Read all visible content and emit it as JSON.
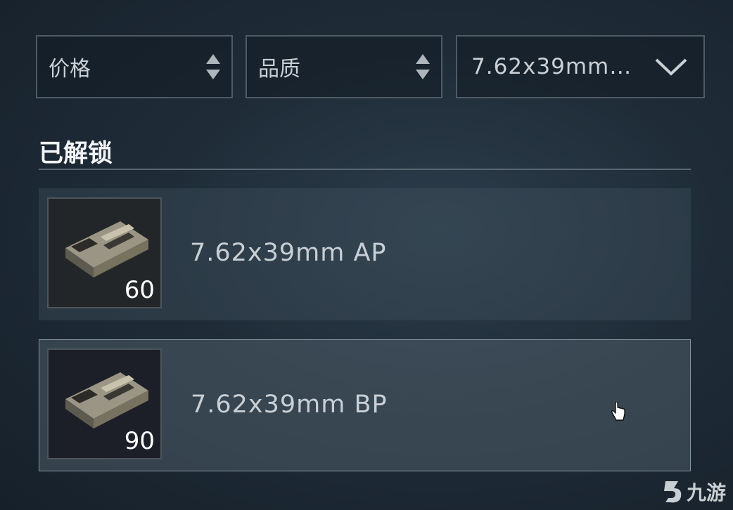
{
  "filters": {
    "price_label": "价格",
    "quality_label": "品质",
    "caliber_label": "7.62x39mm…"
  },
  "section": {
    "title": "已解锁"
  },
  "items": [
    {
      "name": "7.62x39mm AP",
      "quantity": "60"
    },
    {
      "name": "7.62x39mm BP",
      "quantity": "90"
    }
  ],
  "watermark": {
    "text": "九游"
  },
  "colors": {
    "accent_border": "#8a969f",
    "panel": "#1f2c38",
    "text": "#c8cfd5"
  },
  "icons": {
    "sort": "sort-icon",
    "dropdown": "chevron-down-icon",
    "ammo": "ammo-box-icon",
    "cursor": "hand-cursor-icon"
  }
}
